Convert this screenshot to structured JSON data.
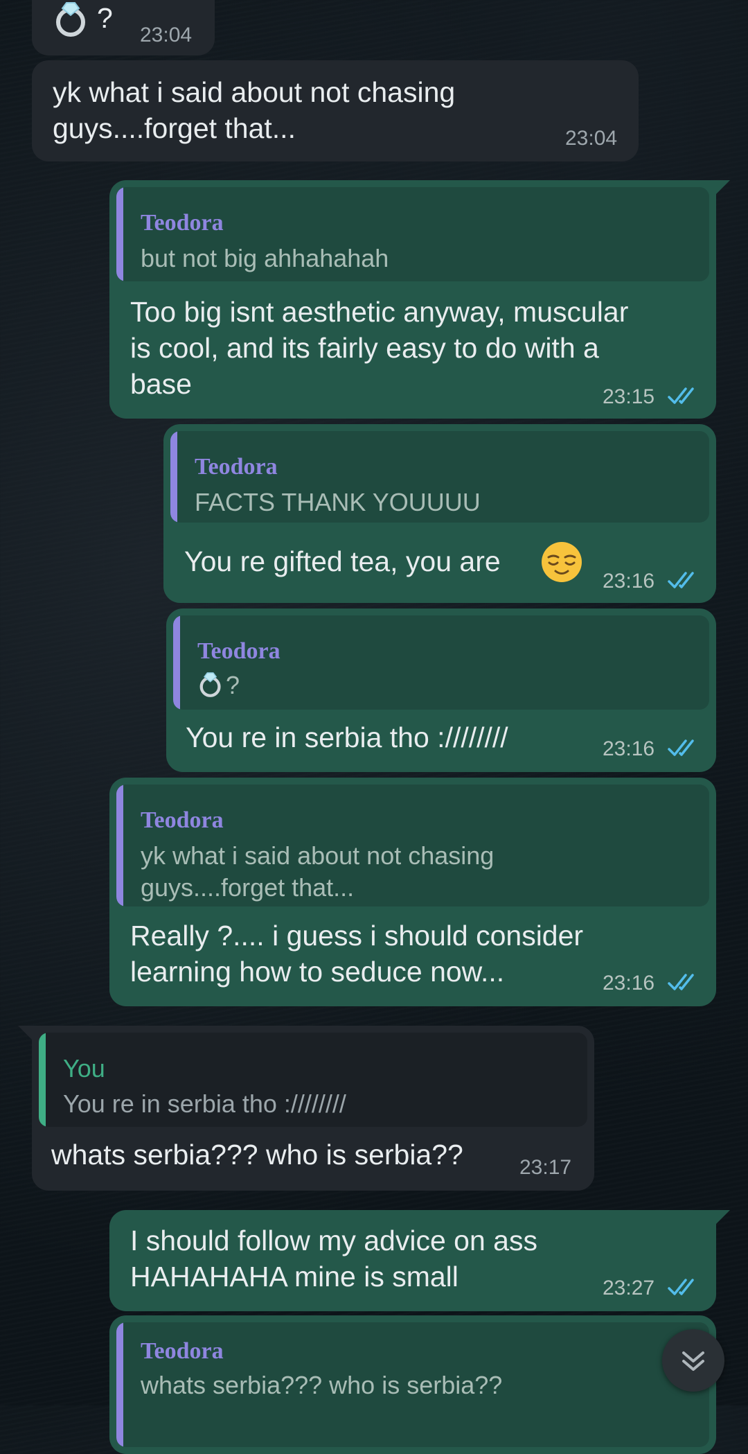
{
  "messages": [
    {
      "sender": "contact",
      "text": "?",
      "attachment_icon": "ring-icon",
      "time": "23:04"
    },
    {
      "sender": "contact",
      "text": "yk what i said about not chasing\nguys....forget that...",
      "time": "23:04"
    },
    {
      "sender": "me",
      "quote": {
        "name": "Teodora",
        "text": "but not big ahhahahah"
      },
      "text": "Too big isnt aesthetic anyway, muscular\nis cool, and its fairly easy to do with a\nbase",
      "time": "23:15",
      "status": "read"
    },
    {
      "sender": "me",
      "quote": {
        "name": "Teodora",
        "text": "FACTS THANK YOUUUU"
      },
      "text": "You re gifted tea, you are",
      "emoji": "relieved-face",
      "time": "23:16",
      "status": "read"
    },
    {
      "sender": "me",
      "quote": {
        "name": "Teodora",
        "text": "?",
        "icon": "ring-icon"
      },
      "text": "You re in serbia tho :////////",
      "time": "23:16",
      "status": "read"
    },
    {
      "sender": "me",
      "quote": {
        "name": "Teodora",
        "text": "yk what i said about not chasing\nguys....forget that..."
      },
      "text": "Really ?.... i guess i should consider\nlearning how to seduce now...",
      "time": "23:16",
      "status": "read"
    },
    {
      "sender": "contact",
      "quote": {
        "name": "You",
        "text": "You re in serbia tho :////////"
      },
      "text": "whats serbia??? who is serbia??",
      "time": "23:17"
    },
    {
      "sender": "me",
      "text": "I should follow my advice on ass\nHAHAHAHA mine is small",
      "time": "23:27",
      "status": "read"
    },
    {
      "sender": "me",
      "quote": {
        "name": "Teodora",
        "text": "whats serbia??? who is serbia??"
      }
    }
  ],
  "colors": {
    "background": "#0d1419",
    "incoming_bubble": "#22272d",
    "outgoing_bubble": "#24584a",
    "quote_name_contact": "#8f86e0",
    "quote_name_you": "#3fae85",
    "read_ticks": "#53bdeb"
  },
  "scroll_button": {
    "icon": "double-chevron-down-icon"
  }
}
